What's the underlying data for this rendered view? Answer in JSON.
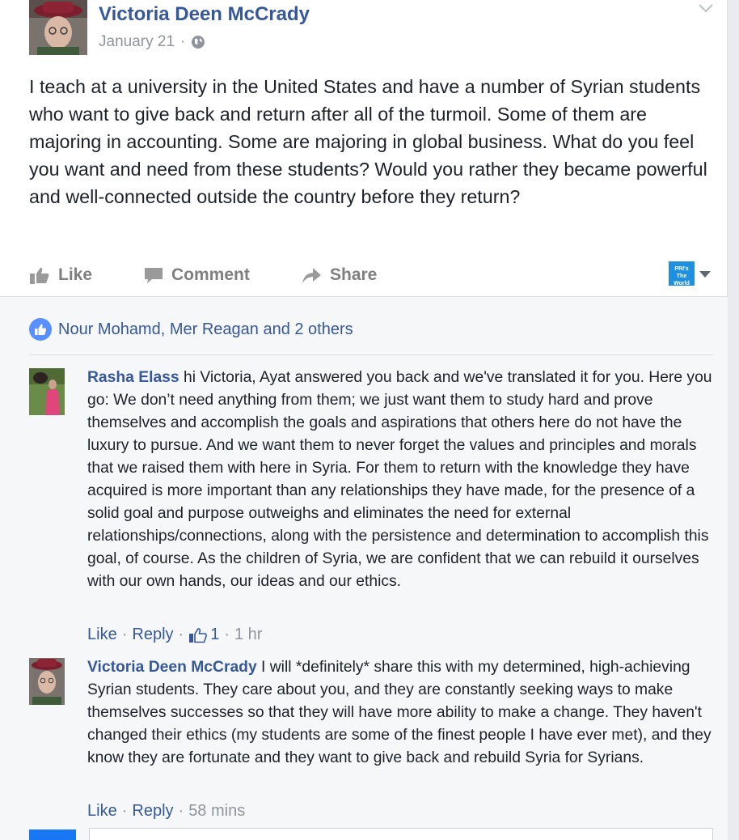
{
  "post": {
    "author": "Victoria Deen McCrady",
    "date": "January 21",
    "meta_separator": "·",
    "text": "I teach at a university in the United States and have a number of Syrian students who want to give back and return after all of the turmoil. Some of them are majoring in accounting. Some are majoring in global business. What do you feel you want and need from these students? Would you rather they became powerful and well-connected outside the country before they return?"
  },
  "actions": {
    "like": "Like",
    "comment": "Comment",
    "share": "Share"
  },
  "page_badge": {
    "line1": "PRI's",
    "line2": "The World"
  },
  "reactions": {
    "text": "Nour Mohamd, Mer Reagan and 2 others"
  },
  "comments": [
    {
      "author": "Rasha Elass",
      "text": "hi Victoria, Ayat answered you back and we've translated it for you. Here you go: We don’t need anything from them; we just want them to study hard and prove themselves and accomplish the goals and aspirations that others here do not have the luxury to pursue. And we want them to never forget the values and principles and morals that we raised them with here in Syria. For them to return with the knowledge they have acquired is more important than any relationships they have made, for the presence of a solid goal and purpose outweighs and eliminates the need for external relationships/connections, along with the persistence and determination to accomplish this goal, of course. As the children of Syria, we are confident that we can rebuild it ourselves with our own hands, our ideas and our ethics.",
      "like": "Like",
      "reply": "Reply",
      "like_count": "1",
      "time": "1 hr",
      "separator": "·"
    },
    {
      "author": "Victoria Deen McCrady",
      "text": "I will *definitely* share this with my determined, high-achieving Syrian students. They care about you, and they are constantly seeking ways to make themselves successes so that they will have more ability to make a change. They haven't changed their ethics (my students are some of the finest people I have ever met), and they know they are fortunate and they want to give back and rebuild Syria for Syrians.",
      "like": "Like",
      "reply": "Reply",
      "time": "58 mins",
      "separator": "·"
    }
  ],
  "colors": {
    "link_blue": "#365899",
    "muted_gray": "#90949c",
    "action_gray": "#7f7f7f",
    "comment_bg": "#f6f7f9",
    "reaction_blue": "#5890ff"
  },
  "icons": {
    "privacy": "globe-icon",
    "menu": "chevron-down-icon",
    "like": "thumbs-up-icon",
    "comment": "speech-bubble-icon",
    "share": "share-arrow-icon"
  }
}
